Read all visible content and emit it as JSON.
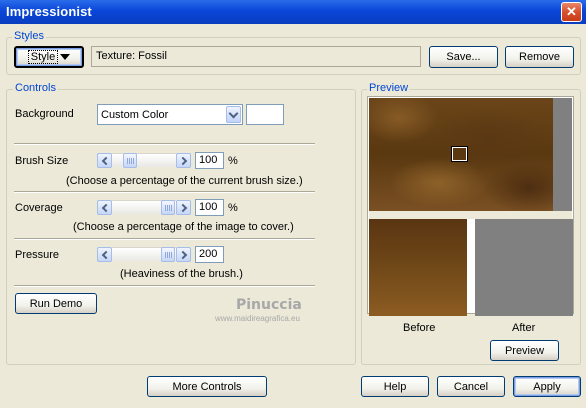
{
  "window": {
    "title": "Impressionist",
    "close_glyph": "✕"
  },
  "styles": {
    "legend": "Styles",
    "style_button": "Style",
    "style_value": "Texture: Fossil",
    "save_label": "Save...",
    "remove_label": "Remove"
  },
  "controls": {
    "legend": "Controls",
    "background": {
      "label": "Background",
      "value": "Custom Color",
      "swatch_color": "#ffffff"
    },
    "brush_size": {
      "label": "Brush Size",
      "value": "100",
      "unit": "%",
      "hint": "(Choose a percentage of the current brush size.)"
    },
    "coverage": {
      "label": "Coverage",
      "value": "100",
      "unit": "%",
      "hint": "(Choose a percentage of the image to cover.)"
    },
    "pressure": {
      "label": "Pressure",
      "value": "200",
      "hint": "(Heaviness of the brush.)"
    },
    "run_demo": "Run Demo"
  },
  "watermark": {
    "name": "Pinuccia",
    "url": "www.maidireagrafica.eu"
  },
  "preview": {
    "legend": "Preview",
    "before_label": "Before",
    "after_label": "After",
    "preview_button": "Preview"
  },
  "footer": {
    "more_controls": "More Controls",
    "help": "Help",
    "cancel": "Cancel",
    "apply": "Apply"
  },
  "colors": {
    "accent": "#0046d5",
    "titlebar": "#0a46d8",
    "after_fill": "#808080",
    "preview_side": "#808080"
  }
}
